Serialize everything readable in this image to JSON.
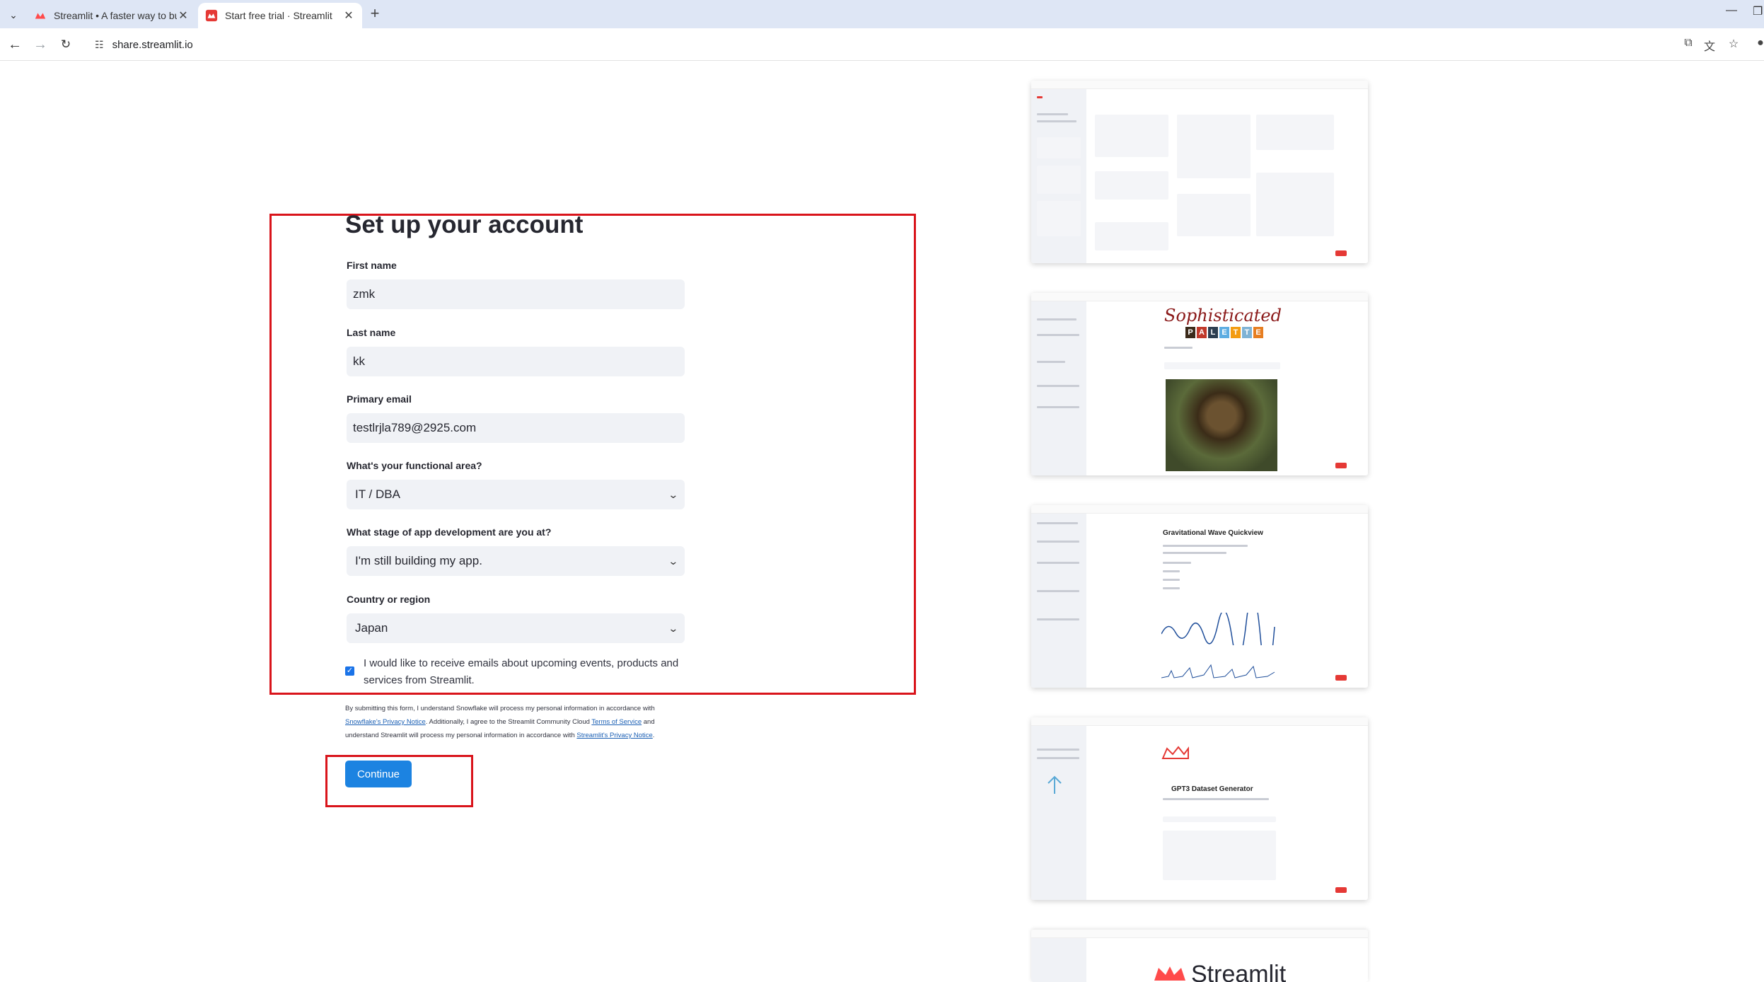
{
  "browser": {
    "tabs": [
      {
        "title": "Streamlit • A faster way to bu",
        "active": false
      },
      {
        "title": "Start free trial · Streamlit",
        "active": true
      }
    ],
    "address": "share.streamlit.io"
  },
  "form": {
    "title": "Set up your account",
    "fields": [
      {
        "label": "First name",
        "value": "zmk"
      },
      {
        "label": "Last name",
        "value": "kk"
      },
      {
        "label": "Primary email",
        "value": "testlrjla789@2925.com"
      },
      {
        "label": "What's your functional area?",
        "value": "IT / DBA"
      },
      {
        "label": "What stage of app development are you at?",
        "value": "I'm still building my app."
      },
      {
        "label": "Country or region",
        "value": "Japan"
      }
    ],
    "consent": {
      "checked": true,
      "label": "I would like to receive emails about upcoming events, products and services from Streamlit."
    },
    "legal": {
      "part1": "By submitting this form, I understand Snowflake will process my personal information in accordance with",
      "link1": "Snowflake's Privacy Notice",
      "part2": ". Additionally, I agree to the Streamlit Community Cloud",
      "link2": "Terms of Service",
      "part3": "and understand Streamlit will process my personal information in accordance with",
      "link3": "Streamlit's Privacy Notice",
      "part4": "."
    },
    "continue_label": "Continue"
  },
  "previews": {
    "palette_title": "Sophisticated",
    "palette_letters": [
      "P",
      "A",
      "L",
      "E",
      "T",
      "T",
      "E"
    ],
    "gw_title": "Gravitational Wave Quickview",
    "gpt_title": "GPT3 Dataset Generator",
    "logo_text": "Streamlit"
  },
  "colors": {
    "highlight": "#d9141b",
    "primary_button": "#1c83e1",
    "input_bg": "#f0f2f6"
  }
}
